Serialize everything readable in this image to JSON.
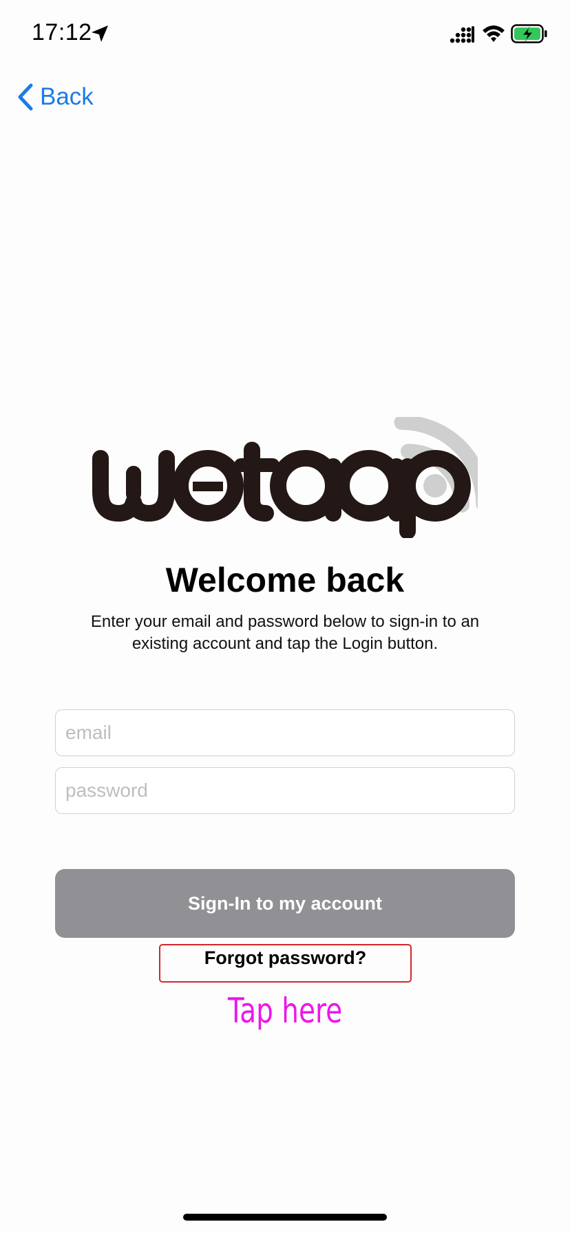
{
  "status_bar": {
    "time": "17:12",
    "icons": [
      "location-arrow-icon",
      "cellular-signal-icon",
      "wifi-icon",
      "battery-charging-icon"
    ],
    "battery_color": "#34c759"
  },
  "nav": {
    "back_label": "Back",
    "accent_color": "#1c7ce4"
  },
  "logo": {
    "text": "wetaap"
  },
  "main": {
    "title": "Welcome back",
    "subtitle": "Enter your email and password below to sign-in to an existing account and tap the Login button."
  },
  "form": {
    "email": {
      "value": "",
      "placeholder": "email"
    },
    "password": {
      "value": "",
      "placeholder": "password"
    },
    "signin_label": "Sign-In to my account",
    "signin_color": "#909095",
    "forgot_label": "Forgot password?"
  },
  "annotation": {
    "text": "Tap here",
    "color": "#ee16e9",
    "box_color": "#d3252a"
  }
}
